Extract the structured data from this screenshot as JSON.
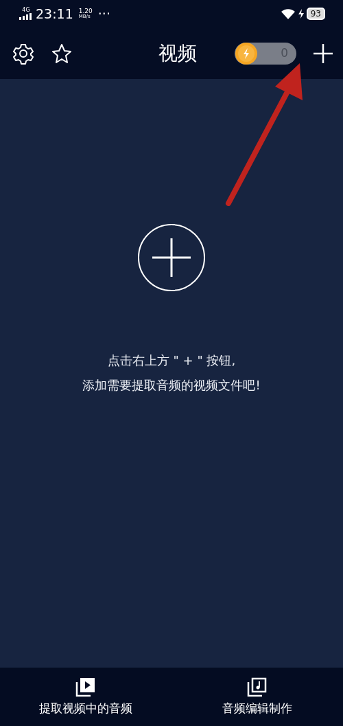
{
  "status_bar": {
    "network": "4G",
    "time": "23:11",
    "speed_value": "1.20",
    "speed_unit": "MB/s",
    "more": "···",
    "battery": "93"
  },
  "header": {
    "title": "视频",
    "coin_count": "0"
  },
  "empty_state": {
    "lines": [
      "点击右上方 \" + \" 按钮,",
      "添加需要提取音频的视频文件吧!"
    ]
  },
  "bottom_tabs": [
    {
      "kind": "video",
      "label": "提取视频中的音频"
    },
    {
      "kind": "audio",
      "label": "音频编辑制作"
    }
  ],
  "annotation": {
    "kind": "arrow"
  }
}
